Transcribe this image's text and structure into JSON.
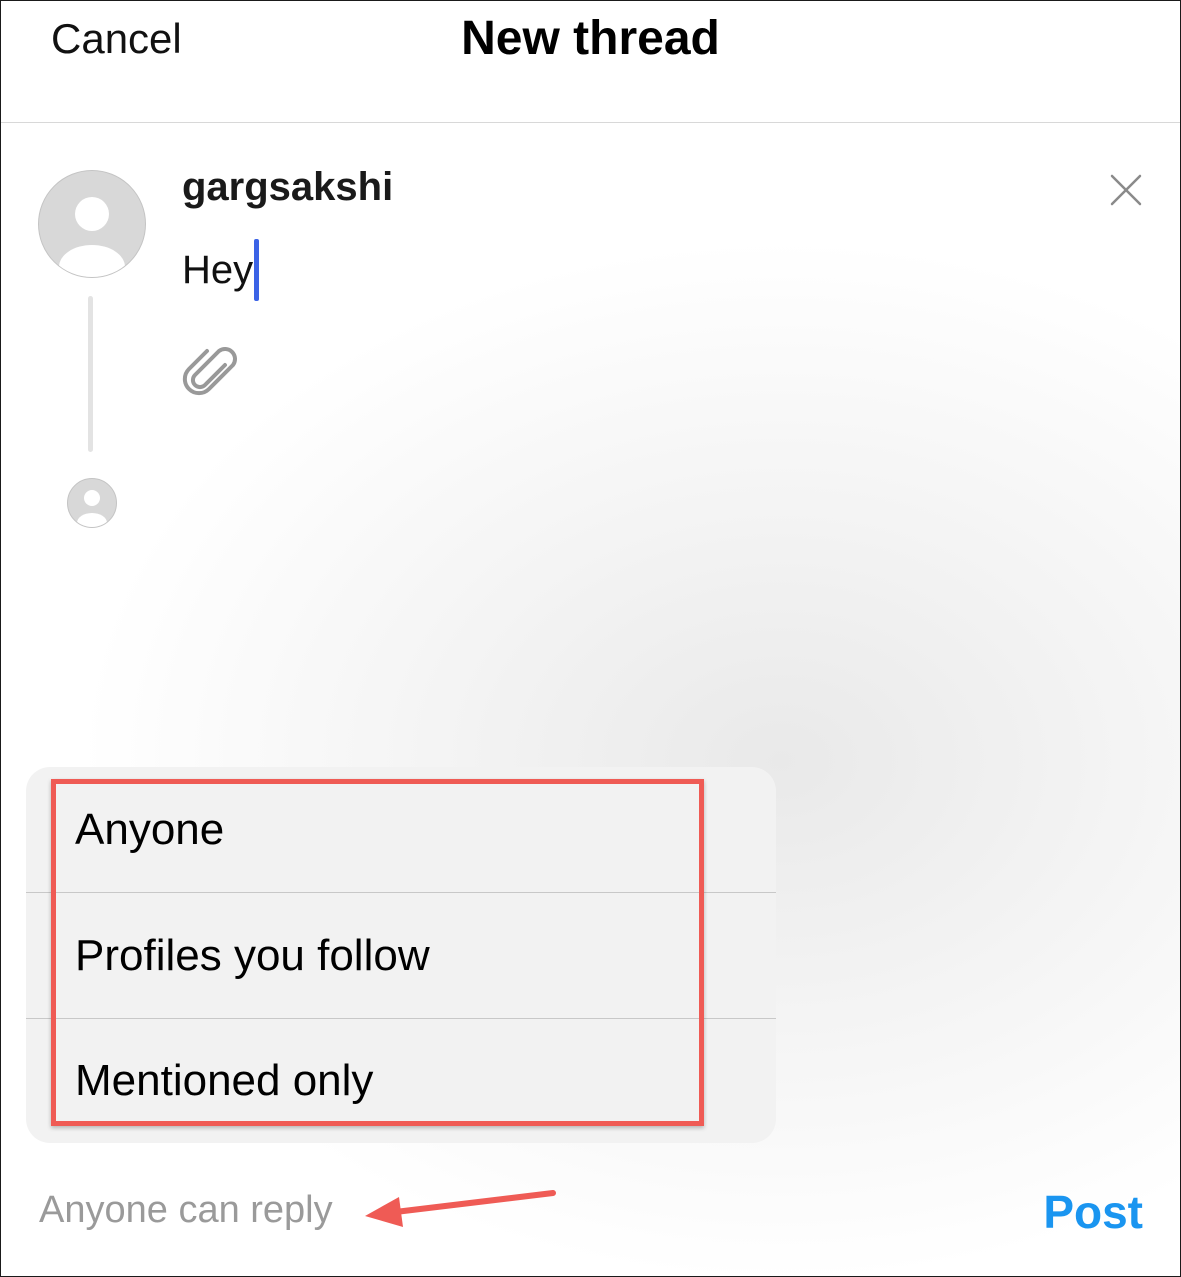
{
  "header": {
    "cancel_label": "Cancel",
    "title": "New thread"
  },
  "composer": {
    "username": "gargsakshi",
    "text": "Hey"
  },
  "reply_menu": {
    "options": [
      "Anyone",
      "Profiles you follow",
      "Mentioned only"
    ]
  },
  "footer": {
    "reply_setting": "Anyone can reply",
    "post_label": "Post"
  },
  "colors": {
    "post_blue": "#1a95f0",
    "caret_blue": "#3b63e6",
    "annotation_red": "#ef5b55"
  },
  "icons": [
    "close-icon",
    "paperclip-icon",
    "avatar-icon"
  ]
}
